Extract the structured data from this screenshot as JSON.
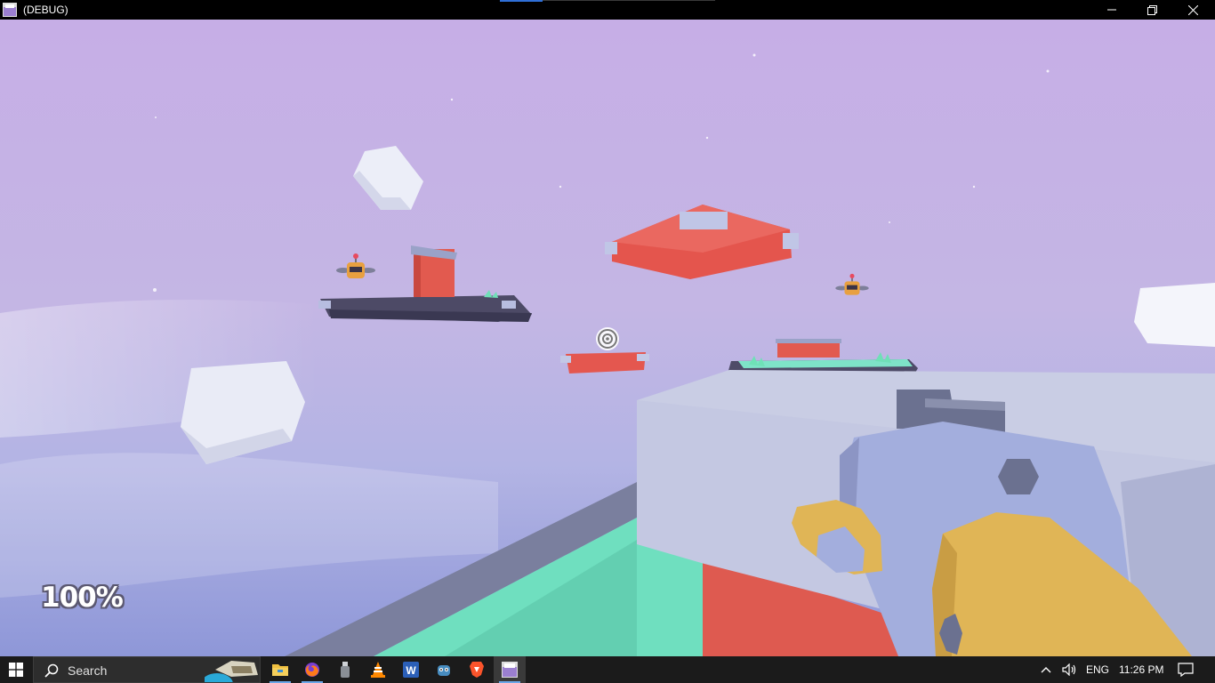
{
  "window": {
    "title": "(DEBUG)",
    "icon": "godot-app-icon",
    "controls": [
      "minimize",
      "restore",
      "close"
    ]
  },
  "hud": {
    "health": "100%",
    "crosshair": "target-reticle"
  },
  "taskbar": {
    "search_placeholder": "Search",
    "apps": [
      {
        "name": "file-explorer",
        "color": "#f0c040",
        "running": true
      },
      {
        "name": "firefox",
        "color": "#ff7a1a",
        "running": true
      },
      {
        "name": "usb-device",
        "color": "#9aa0a6",
        "running": false
      },
      {
        "name": "vlc",
        "color": "#ff8800",
        "running": false
      },
      {
        "name": "word",
        "color": "#2b5fb8",
        "running": false
      },
      {
        "name": "godot",
        "color": "#478cbf",
        "running": false
      },
      {
        "name": "brave",
        "color": "#fb542b",
        "running": false
      },
      {
        "name": "game-debug",
        "color": "#9b7fd0",
        "running": true,
        "active": true
      }
    ],
    "tray": {
      "language": "ENG",
      "time": "11:26 PM"
    }
  },
  "colors": {
    "sky_top": "#c6aee6",
    "sky_bottom": "#8e97d8",
    "platform_red": "#e55a52",
    "platform_teal": "#6fe0c0",
    "weapon_blue": "#a3aedd",
    "weapon_yellow": "#e0b556"
  }
}
